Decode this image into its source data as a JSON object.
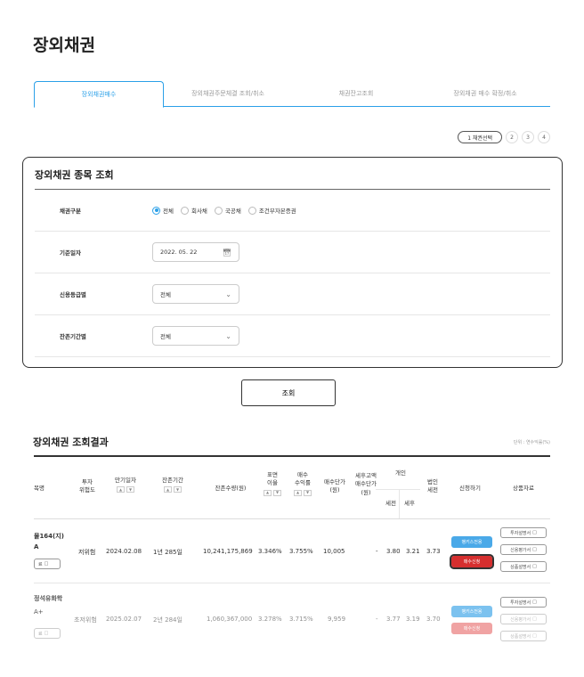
{
  "page_title": "장외채권",
  "tabs": [
    {
      "label": "장외채권매수"
    },
    {
      "label": "장외채권주문체결 조회/취소"
    },
    {
      "label": "채권잔고조회"
    },
    {
      "label": "장외채권 매수 확정/취소"
    }
  ],
  "pager": {
    "pill": "1 채권선택",
    "pages": [
      "2",
      "3",
      "4"
    ]
  },
  "search": {
    "title": "장외채권 종목 조회",
    "bond_type": {
      "label": "채권구분",
      "options": [
        "전체",
        "회사채",
        "국공채",
        "조건부자본증권"
      ],
      "selected": "전체"
    },
    "base_date": {
      "label": "기준일자",
      "value": "2022. 05. 22"
    },
    "credit": {
      "label": "신용등급별",
      "value": "전체"
    },
    "remaining": {
      "label": "잔존기간별",
      "value": "전체"
    },
    "submit": "조회"
  },
  "results": {
    "title": "장외채권 조회결과",
    "unit": "단위 : 연수익률(%)",
    "headers": {
      "name": "목명",
      "risk": "투자\n위험도",
      "maturity": "만기일자",
      "remain": "잔존기간",
      "qty": "잔존수량(원)",
      "coupon": "표면\n이율",
      "yield": "매수\n수익률",
      "price": "매수단가\n(원)",
      "after_tax": "세후고액\n매수단가\n(원)",
      "indiv": "개인",
      "pre": "세전",
      "post": "세후",
      "corp": "법인\n세전",
      "apply": "신청하기",
      "docs": "상품자료"
    },
    "rows": [
      {
        "name_line1": "물164(지)",
        "name_line2": "A",
        "name_btn": "료",
        "risk": "저위험",
        "maturity": "2024.02.08",
        "remain": "1년 285일",
        "qty": "10,241,175,869",
        "coupon": "3.346%",
        "yield": "3.755%",
        "price": "10,005",
        "after": "-",
        "pre": "3.80",
        "post": "3.21",
        "corp": "3.73",
        "btn_bank": "뱅키스전용",
        "btn_buy": "매수신청",
        "docs": [
          "투자설명서",
          "신용평가서",
          "상품설명서"
        ]
      },
      {
        "name_line1": "정석유화학",
        "name_line2": "A+",
        "name_btn": "료",
        "risk": "초저위험",
        "maturity": "2025.02.07",
        "remain": "2년 284일",
        "qty": "1,060,367,000",
        "coupon": "3.278%",
        "yield": "3.715%",
        "price": "9,959",
        "after": "-",
        "pre": "3.77",
        "post": "3.19",
        "corp": "3.70",
        "btn_bank": "뱅키스전용",
        "btn_buy": "매수신청",
        "docs": [
          "투자설명서",
          "신용평가서",
          "상품설명서"
        ]
      }
    ]
  },
  "icons": {
    "calendar": "calendar-icon",
    "chevron": "chevron-down-icon",
    "doc": "document-icon"
  },
  "colors": {
    "accent": "#2ba0e8",
    "buy": "#d62f2f",
    "bankis": "#4aa9e8"
  }
}
